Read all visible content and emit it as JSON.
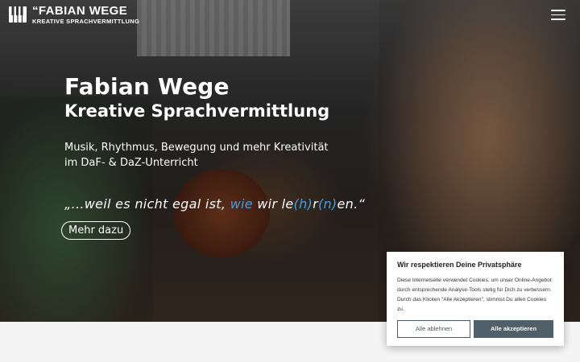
{
  "header": {
    "logo_name": "“FABIAN WEGE",
    "logo_sub": "KREATIVE SPRACHVERMITTLUNG",
    "menu_icon": "hamburger-menu-icon"
  },
  "hero": {
    "title": "Fabian Wege",
    "subtitle": "Kreative Sprachvermittlung",
    "tagline": "Musik, Rhythmus, Bewegung und mehr Kreativität im DaF- & DaZ-Unterricht",
    "quote_part1": "„...weil es nicht egal ist, ",
    "quote_wie": "wie",
    "quote_part2": " wir le",
    "quote_hr": "(h)",
    "quote_r": "r",
    "quote_n": "(n)",
    "quote_part3": "en.“",
    "cta_label": "Mehr dazu"
  },
  "cookie": {
    "title": "Wir respektieren Deine Privatsphäre",
    "text": "Diese Internetseite verwendet Cookies, um unser Online-Angebot durch entsprechende Analyse-Tools stetig für Dich zu verbessern. Durch das Klicken \"Alle Akzeptieren\", stimmst Du allen Cookies zu.",
    "decline_label": "Alle ablehnen",
    "accept_label": "Alle akzeptieren"
  },
  "colors": {
    "accent_blue": "#3aa0e8",
    "button_dark": "#4f606a"
  }
}
